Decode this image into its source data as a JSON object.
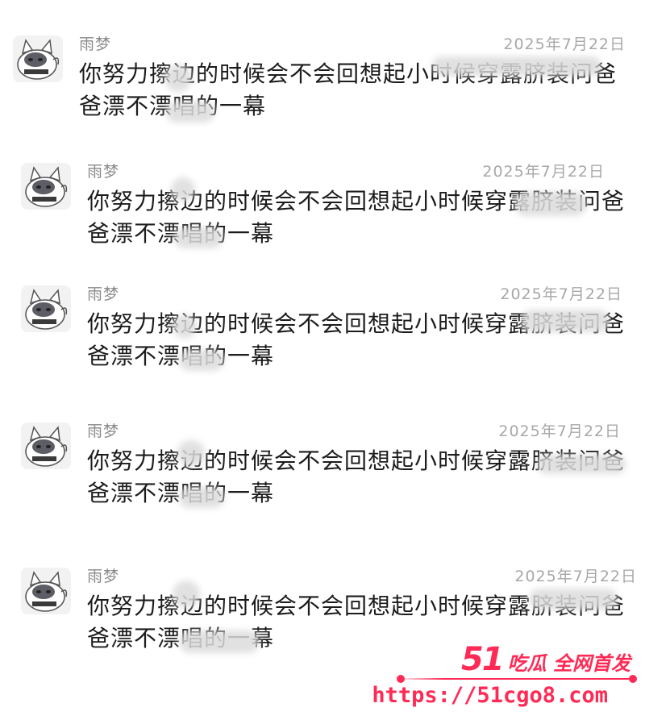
{
  "comments": [
    {
      "username": "雨梦",
      "date": "2025年7月22日",
      "text": "你努力擦边的时候会不会回想起小时候穿露脐装问爸爸漂不漂唱的一幕"
    },
    {
      "username": "雨梦",
      "date": "2025年7月22日",
      "text": "你努力擦边的时候会不会回想起小时候穿露脐装问爸爸漂不漂唱的一幕"
    },
    {
      "username": "雨梦",
      "date": "2025年7月22日",
      "text": "你努力擦边的时候会不会回想起小时候穿露脐装问爸爸漂不漂唱的一幕"
    },
    {
      "username": "雨梦",
      "date": "2025年7月22日",
      "text": "你努力擦边的时候会不会回想起小时候穿露脐装问爸爸漂不漂唱的一幕"
    },
    {
      "username": "雨梦",
      "date": "2025年7月22日",
      "text": "你努力擦边的时候会不会回想起小时候穿露脐装问爸爸漂不漂唱的一幕"
    }
  ],
  "watermark": {
    "brand_num": "51",
    "brand_text": "吃瓜 全网首发",
    "url": "https://51cgo8.com",
    "color": "#ff2a55"
  }
}
